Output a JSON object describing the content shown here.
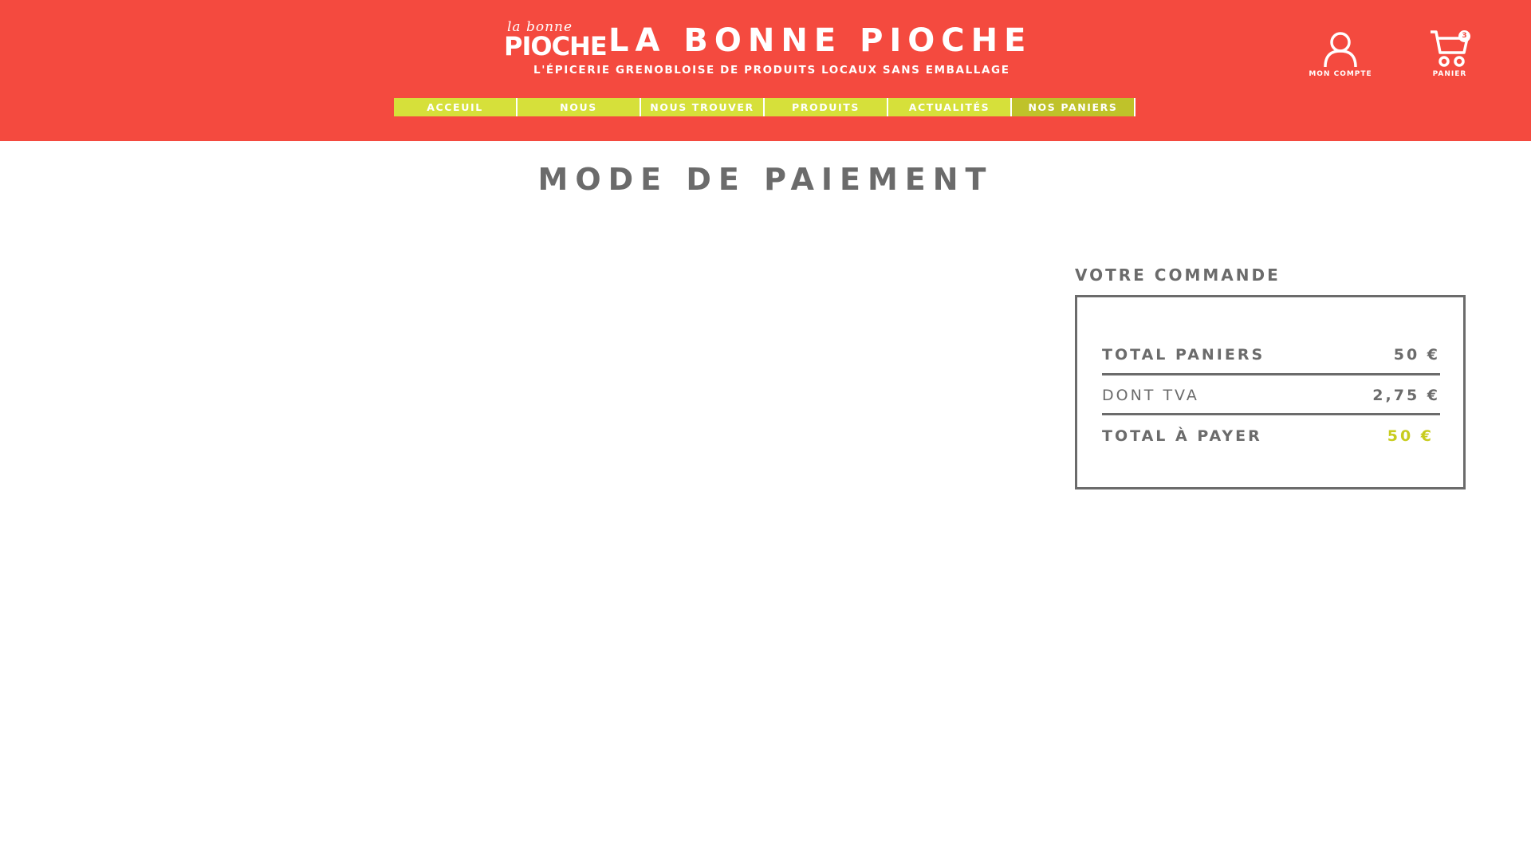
{
  "header": {
    "logo_small": "la bonne",
    "logo_big": "PIOCHE",
    "title": "LA BONNE PIOCHE",
    "tagline": "L'ÉPICERIE GRENOBLOISE DE PRODUITS LOCAUX SANS EMBALLAGE"
  },
  "nav": {
    "items": [
      {
        "label": "ACCEUIL"
      },
      {
        "label": "NOUS"
      },
      {
        "label": "NOUS TROUVER"
      },
      {
        "label": "PRODUITS"
      },
      {
        "label": "ACTUALITÉS"
      },
      {
        "label": "NOS PANIERS"
      }
    ],
    "active": "NOS PANIERS"
  },
  "account": {
    "label": "MON COMPTE",
    "icon": "user-icon"
  },
  "cart": {
    "label": "PANIER",
    "count": "3",
    "icon": "cart-icon"
  },
  "page": {
    "title": "MODE DE PAIEMENT"
  },
  "order": {
    "heading": "VOTRE COMMANDE",
    "rows": [
      {
        "label": "TOTAL PANIERS",
        "value": "50 €"
      },
      {
        "label": "DONT TVA",
        "value": "2,75 €"
      },
      {
        "label": "TOTAL À PAYER",
        "value": "50 €"
      }
    ]
  },
  "colors": {
    "header_bg": "#f44a3f",
    "nav_bg": "#d6e03a",
    "nav_active_bg": "#bfc22a",
    "text": "#6b6b6b",
    "total_accent": "#c8cc1e"
  }
}
